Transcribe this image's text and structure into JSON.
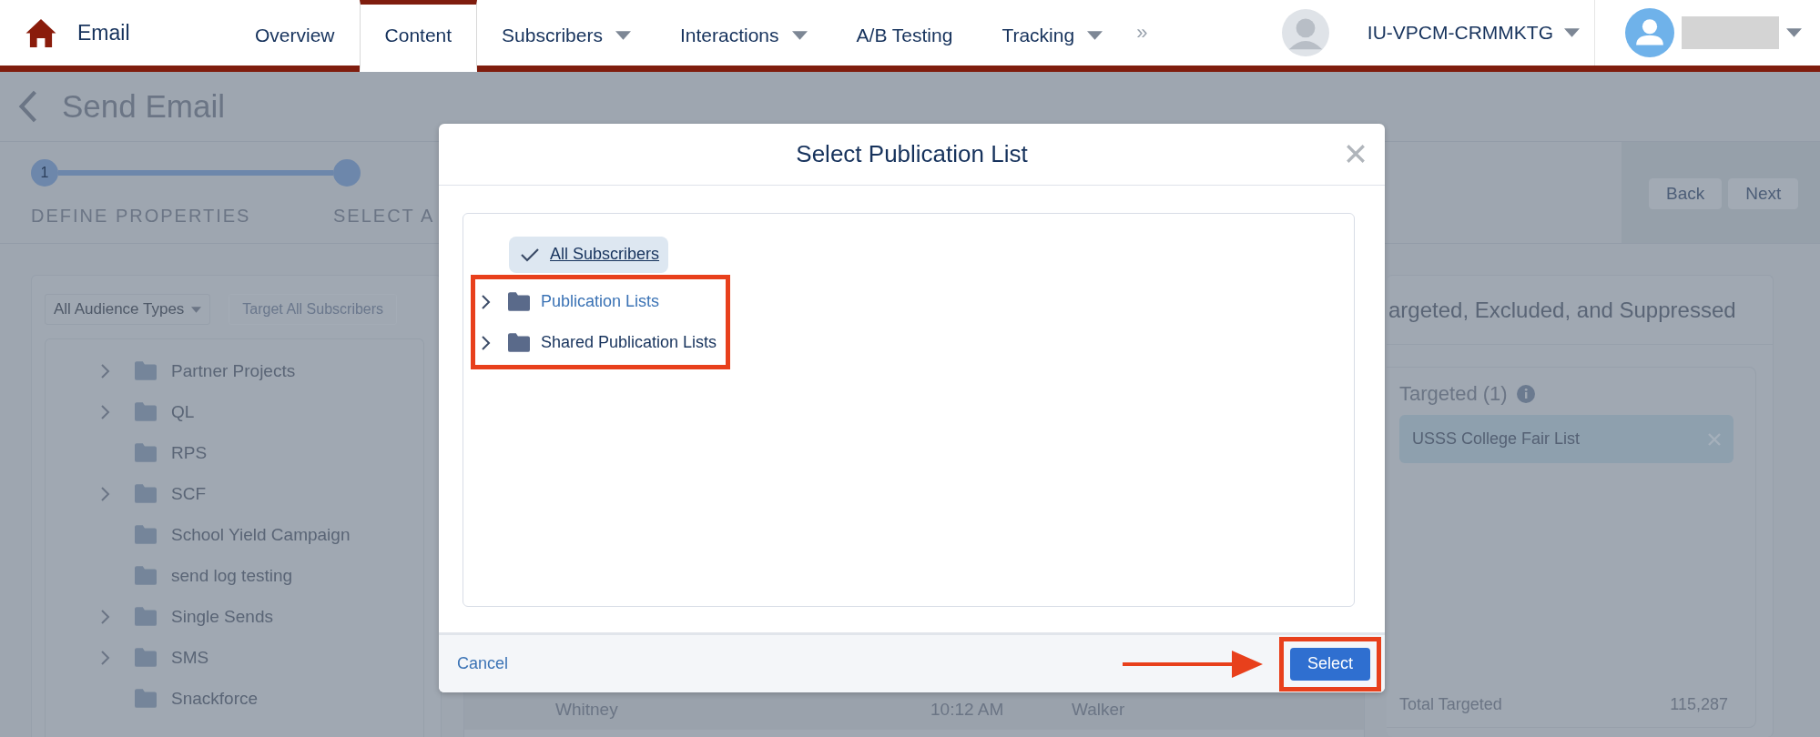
{
  "nav": {
    "app_title": "Email",
    "tabs": [
      {
        "label": "Overview",
        "selected": false,
        "has_menu": false
      },
      {
        "label": "Content",
        "selected": true,
        "has_menu": false
      },
      {
        "label": "Subscribers",
        "selected": false,
        "has_menu": true
      },
      {
        "label": "Interactions",
        "selected": false,
        "has_menu": true
      },
      {
        "label": "A/B Testing",
        "selected": false,
        "has_menu": false
      },
      {
        "label": "Tracking",
        "selected": false,
        "has_menu": true
      }
    ],
    "overflow": "»",
    "account": {
      "name": "IU-VPCM-CRMMKTG",
      "has_menu": true
    }
  },
  "page": {
    "title": "Send Email",
    "steps": [
      {
        "number": "1",
        "label": "DEFINE PROPERTIES"
      },
      {
        "label": "SELECT A"
      }
    ],
    "buttons": [
      "Back",
      "Next"
    ]
  },
  "audience_panel": {
    "filter": "All Audience Types",
    "target_all": {
      "label": "Target All Subscribers",
      "disabled": true
    },
    "folders": [
      {
        "label": "Partner Projects",
        "has_children": true
      },
      {
        "label": "QL",
        "has_children": true
      },
      {
        "label": "RPS",
        "has_children": false
      },
      {
        "label": "SCF",
        "has_children": true
      },
      {
        "label": "School Yield Campaign",
        "has_children": false
      },
      {
        "label": "send log testing",
        "has_children": false
      },
      {
        "label": "Single Sends",
        "has_children": true
      },
      {
        "label": "SMS",
        "has_children": true
      },
      {
        "label": "Snackforce",
        "has_children": false
      }
    ]
  },
  "sends_table": {
    "rows": [
      {
        "column_1": "Whitney",
        "column_2": "10:12 AM",
        "column_3": "Walker"
      }
    ]
  },
  "summary_panel": {
    "title": "argeted, Excluded, and Suppressed",
    "targeted_heading": "Targeted (1)",
    "targeted": [
      {
        "label": "USSS College Fair List",
        "removable": true
      }
    ],
    "total_label": "Total Targeted",
    "total_value": "115,287"
  },
  "modal": {
    "title": "Select Publication List",
    "tree": [
      {
        "label": "All Subscribers",
        "kind": "root",
        "selected": true
      },
      {
        "label": "Publication Lists",
        "kind": "folder",
        "selected": false,
        "expanded": false,
        "hovered": true
      },
      {
        "label": "Shared Publication Lists",
        "kind": "folder",
        "selected": false,
        "expanded": false,
        "hovered": false
      }
    ],
    "highlight_folders": true,
    "cancel": "Cancel",
    "select_button": {
      "label": "Select",
      "highlighted": true,
      "pointer_arrow": true
    }
  }
}
